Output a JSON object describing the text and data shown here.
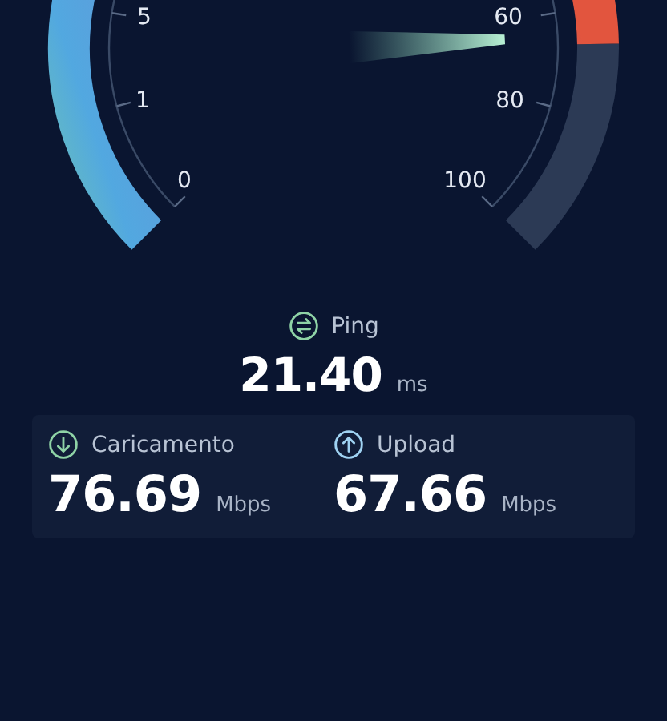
{
  "gauge": {
    "scale_labels": [
      "5",
      "1",
      "0",
      "60",
      "80",
      "100"
    ]
  },
  "ping": {
    "label": "Ping",
    "value": "21.40",
    "unit": "ms"
  },
  "results": [
    {
      "kind": "download",
      "label": "Caricamento",
      "value": "76.69",
      "unit": "Mbps"
    },
    {
      "kind": "upload",
      "label": "Upload",
      "value": "67.66",
      "unit": "Mbps"
    }
  ]
}
